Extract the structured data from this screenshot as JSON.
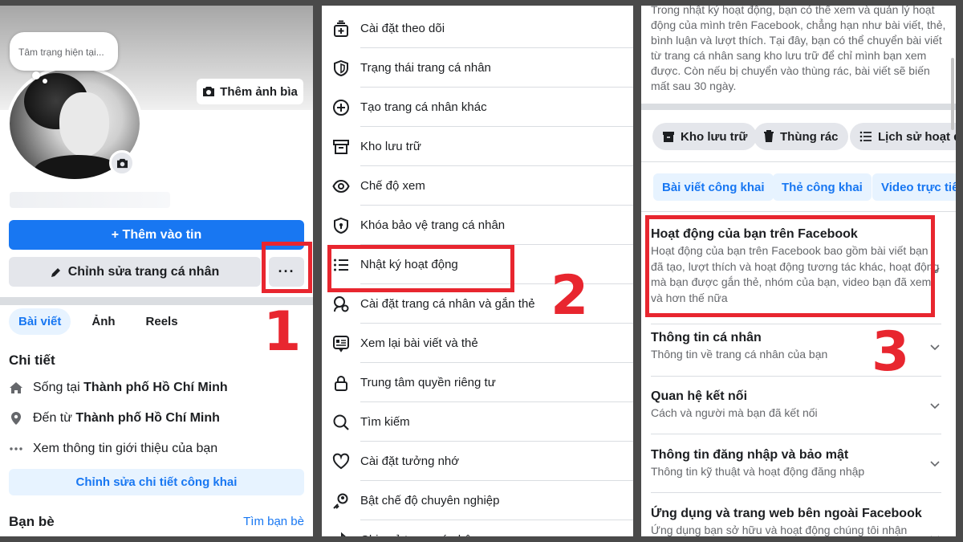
{
  "panel1": {
    "mood_placeholder": "Tâm trạng hiện tại...",
    "add_cover_label": "Thêm ảnh bìa",
    "add_story_label": "+ Thêm vào tin",
    "edit_profile_label": "Chỉnh sửa trang cá nhân",
    "more_label": "···",
    "tabs": [
      {
        "label": "Bài viết"
      },
      {
        "label": "Ảnh"
      },
      {
        "label": "Reels"
      }
    ],
    "details_title": "Chi tiết",
    "details": [
      {
        "icon": "home-icon",
        "prefix": "Sống tại ",
        "value": "Thành phố Hồ Chí Minh"
      },
      {
        "icon": "location-pin-icon",
        "prefix": "Đến từ ",
        "value": "Thành phố Hồ Chí Minh"
      },
      {
        "icon": "more-dots-icon",
        "prefix": "Xem thông tin giới thiệu của bạn",
        "value": ""
      }
    ],
    "edit_public_details_label": "Chỉnh sửa chi tiết công khai",
    "friends_title": "Bạn bè",
    "find_friends_label": "Tìm bạn bè",
    "step_number": "1"
  },
  "panel2": {
    "items": [
      {
        "label": "Cài đặt theo dõi",
        "icon": "follow-settings-icon"
      },
      {
        "label": "Trạng thái trang cá nhân",
        "icon": "shield-icon"
      },
      {
        "label": "Tạo trang cá nhân khác",
        "icon": "plus-circle-icon"
      },
      {
        "label": "Kho lưu trữ",
        "icon": "archive-icon"
      },
      {
        "label": "Chế độ xem",
        "icon": "eye-icon"
      },
      {
        "label": "Khóa bảo vệ trang cá nhân",
        "icon": "lock-shield-icon"
      },
      {
        "label": "Nhật ký hoạt động",
        "icon": "list-icon"
      },
      {
        "label": "Cài đặt trang cá nhân và gắn thẻ",
        "icon": "profile-gear-icon"
      },
      {
        "label": "Xem lại bài viết và thẻ",
        "icon": "review-posts-icon"
      },
      {
        "label": "Trung tâm quyền riêng tư",
        "icon": "lock-icon"
      },
      {
        "label": "Tìm kiếm",
        "icon": "search-icon"
      },
      {
        "label": "Cài đặt tưởng nhớ",
        "icon": "heart-icon"
      },
      {
        "label": "Bật chế độ chuyên nghiệp",
        "icon": "professional-icon"
      },
      {
        "label": "Chia sẻ trang cá nhân",
        "icon": "share-icon"
      }
    ],
    "step_number": "2"
  },
  "panel3": {
    "description": "Trong nhật ký hoạt động, bạn có thể xem và quản lý hoạt động của mình trên Facebook, chẳng hạn như bài viết, thẻ, bình luận và lượt thích. Tại đây, bạn có thể chuyển bài viết từ trang cá nhân sang kho lưu trữ để chỉ mình bạn xem được. Còn nếu bị chuyển vào thùng rác, bài viết sẽ biến mất sau 30 ngày.",
    "chips": [
      {
        "label": "Kho lưu trữ",
        "icon": "archive-icon"
      },
      {
        "label": "Thùng rác",
        "icon": "trash-icon"
      },
      {
        "label": "Lịch sử hoạt động",
        "icon": "list-icon"
      }
    ],
    "filters": [
      {
        "label": "Bài viết công khai"
      },
      {
        "label": "Thẻ công khai"
      },
      {
        "label": "Video trực tiếp"
      }
    ],
    "sections": [
      {
        "title": "Hoạt động của bạn trên Facebook",
        "desc": "Hoạt động của bạn trên Facebook bao gồm bài viết bạn đã tạo, lượt thích và hoạt động tương tác khác, hoạt động mà bạn được gắn thẻ, nhóm của bạn, video bạn đã xem và hơn thế nữa"
      },
      {
        "title": "Thông tin cá nhân",
        "desc": "Thông tin về trang cá nhân của bạn"
      },
      {
        "title": "Quan hệ kết nối",
        "desc": "Cách và người mà bạn đã kết nối"
      },
      {
        "title": "Thông tin đăng nhập và bảo mật",
        "desc": "Thông tin kỹ thuật và hoạt động đăng nhập"
      },
      {
        "title": "Ứng dụng và trang web bên ngoài Facebook",
        "desc": "Ứng dụng bạn sở hữu và hoạt động chúng tôi nhận"
      }
    ],
    "step_number": "3"
  },
  "colors": {
    "accent": "#1877f2",
    "highlight": "#e8262f",
    "chip_bg": "#e4e6eb",
    "chip_blue_bg": "#e7f3ff"
  }
}
